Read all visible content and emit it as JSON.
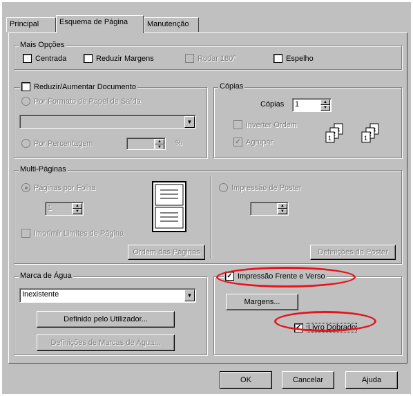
{
  "tabs": [
    {
      "label": "Principal"
    },
    {
      "label": "Esquema de Página"
    },
    {
      "label": "Manutenção"
    }
  ],
  "mais_opcoes": {
    "title": "Mais Opções",
    "centrada": "Centrada",
    "reduzir_margens": "Reduzir Margens",
    "rodar_180": "Rodar 180°",
    "espelho": "Espelho"
  },
  "reduzir_doc": {
    "title": "Reduzir/Aumentar Documento",
    "por_formato": "Por Formato de Papel de Saída",
    "formato_value": "",
    "por_percentagem": "Por Percentagem",
    "percent_value": "",
    "percent_unit": "%"
  },
  "copias": {
    "title": "Cópias",
    "label": "Cópias",
    "value": "1",
    "inverter": "Inverter Ordem",
    "agrupar": "Agrupar"
  },
  "multi_paginas": {
    "title": "Multi-Páginas",
    "paginas_por_folha": "Páginas por Folha",
    "paginas_value": "1",
    "imprimir_limites": "Imprimir Limites de Página",
    "ordem_btn": "Ordem das Páginas",
    "impressao_poster": "Impressão de Poster",
    "poster_value": "",
    "definicoes_poster": "Definições do Poster"
  },
  "marca_agua": {
    "title": "Marca de Água",
    "selected": "Inexistente",
    "definido_btn": "Definido pelo Utilizador...",
    "definicoes_btn": "Definições de Marcas de Água..."
  },
  "frente_verso": {
    "label": "Impressão Frente e Verso",
    "margens_btn": "Margens...",
    "livro_dobrado": "Livro Dobrado"
  },
  "footer": {
    "ok": "OK",
    "cancelar": "Cancelar",
    "ajuda": "Ajuda"
  },
  "colors": {
    "dialog_bg": "#c0c0c0",
    "highlight": "#e8141c"
  }
}
